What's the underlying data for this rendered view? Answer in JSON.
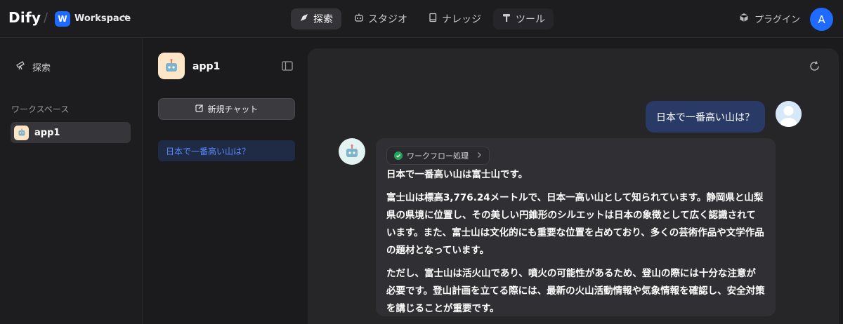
{
  "header": {
    "logo": "Dify",
    "workspace_initial": "W",
    "workspace_name": "Workspace",
    "nav": [
      {
        "label": "探索",
        "icon": "compass-icon",
        "active": true
      },
      {
        "label": "スタジオ",
        "icon": "robot-icon",
        "active": false
      },
      {
        "label": "ナレッジ",
        "icon": "book-icon",
        "active": false
      },
      {
        "label": "ツール",
        "icon": "hammer-icon",
        "active": false
      }
    ],
    "plugin_label": "プラグイン",
    "user_initial": "A"
  },
  "sidebar": {
    "explore_label": "探索",
    "section_label": "ワークスペース",
    "apps": [
      {
        "name": "app1"
      }
    ]
  },
  "conversation_panel": {
    "app_name": "app1",
    "new_chat_label": "新規チャット",
    "conversations": [
      {
        "title": "日本で一番高い山は？"
      }
    ]
  },
  "chat": {
    "user_message": "日本で一番高い山は？",
    "workflow_label": "ワークフロー処理",
    "answer_paragraphs": [
      "日本で一番高い山は富士山です。",
      "富士山は標高3,776.24メートルで、日本一高い山として知られています。静岡県と山梨県の県境に位置し、その美しい円錐形のシルエットは日本の象徴として広く認識されています。また、富士山は文化的にも重要な位置を占めており、多くの芸術作品や文学作品の題材となっています。",
      "ただし、富士山は活火山であり、噴火の可能性があるため、登山の際には十分な注意が必要です。登山計画を立てる際には、最新の火山活動情報や気象情報を確認し、安全対策を講じることが重要です。"
    ]
  },
  "colors": {
    "accent": "#1f6bff",
    "success": "#22a55a",
    "user_bubble": "#2a3a66"
  }
}
